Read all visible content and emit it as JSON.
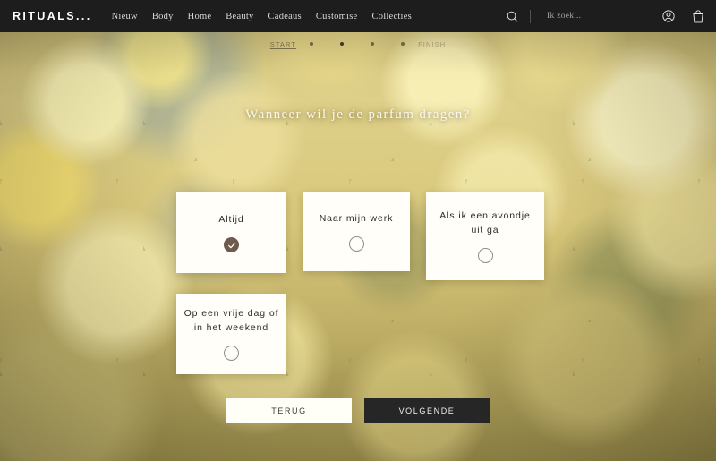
{
  "navbar": {
    "logo": "RITUALS...",
    "links": [
      {
        "label": "Nieuw"
      },
      {
        "label": "Body"
      },
      {
        "label": "Home"
      },
      {
        "label": "Beauty"
      },
      {
        "label": "Cadeaus"
      },
      {
        "label": "Customise"
      },
      {
        "label": "Collecties"
      }
    ],
    "search": {
      "placeholder": "Ik zoek...",
      "icon": "search-icon"
    },
    "account_icon": "account-icon",
    "cart_icon": "shopping-bag-icon",
    "background_color": "#1d1d1d"
  },
  "stepbar": {
    "start_label": "START",
    "end_label": "FINISH",
    "total_steps": 4,
    "active_step": 2
  },
  "main": {
    "question": "Wanneer wil je de parfum dragen?",
    "options": [
      {
        "label": "Altijd",
        "selected": true
      },
      {
        "label": "Naar mijn werk",
        "selected": false
      },
      {
        "label": "Als ik een avondje uit ga",
        "selected": false
      },
      {
        "label": "Op een vrije dag of in het weekend",
        "selected": false
      }
    ],
    "selected_color": "#6e5b4e"
  },
  "actions": {
    "back_label": "TERUG",
    "next_label": "VOLGENDE",
    "back_color": "#fffef7",
    "next_color": "#262626"
  }
}
